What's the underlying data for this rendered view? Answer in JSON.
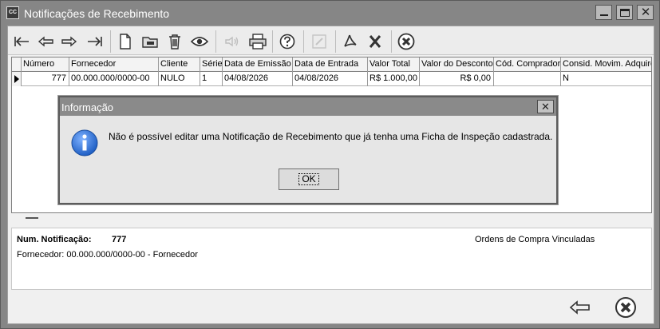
{
  "window": {
    "title": "Notificações de Recebimento",
    "app_icon_text": "CC"
  },
  "toolbar": {
    "buttons": [
      {
        "name": "first-record",
        "icon": "first-arrow-icon"
      },
      {
        "name": "previous-record",
        "icon": "left-arrow-icon"
      },
      {
        "name": "next-record",
        "icon": "right-arrow-icon"
      },
      {
        "name": "last-record",
        "icon": "last-arrow-icon"
      },
      {
        "name": "new",
        "icon": "new-document-icon"
      },
      {
        "name": "edit",
        "icon": "edit-folder-icon"
      },
      {
        "name": "delete",
        "icon": "trash-icon"
      },
      {
        "name": "view",
        "icon": "eye-icon"
      },
      {
        "name": "sound",
        "icon": "speaker-icon",
        "disabled": true
      },
      {
        "name": "print",
        "icon": "printer-icon"
      },
      {
        "name": "help",
        "icon": "help-icon"
      },
      {
        "name": "edit-disabled",
        "icon": "pencil-icon",
        "disabled": true
      },
      {
        "name": "pdf",
        "icon": "pdf-icon"
      },
      {
        "name": "excel",
        "icon": "excel-icon"
      },
      {
        "name": "cancel",
        "icon": "cancel-circle-icon"
      }
    ]
  },
  "grid": {
    "columns": [
      "Número",
      "Fornecedor",
      "Cliente",
      "Série",
      "Data de Emissão",
      "Data de Entrada",
      "Valor Total",
      "Valor do Desconto",
      "Cód. Comprador",
      "Consid. Movim. Adquire"
    ],
    "rows": [
      [
        "777",
        "00.000.000/0000-00",
        "NULO",
        "1",
        "04/08/2026",
        "04/08/2026",
        "R$ 1.000,00",
        "R$ 0,00",
        "",
        "N"
      ]
    ]
  },
  "info": {
    "num_label": "Num. Notificação:",
    "num_value": "777",
    "orders_label": "Ordens de Compra Vinculadas",
    "fornecedor_text": "Fornecedor: 00.000.000/0000-00 - Fornecedor"
  },
  "dialog": {
    "title": "Informação",
    "close_glyph": "✕",
    "message": "Não é possível editar uma Notificação de Recebimento que já tenha uma Ficha de Inspeção cadastrada.",
    "ok_label": "OK"
  },
  "colors": {
    "titlebar": "#868686",
    "client_bg": "#f0f0f0",
    "info_icon_blue": "#1f5fc4"
  }
}
